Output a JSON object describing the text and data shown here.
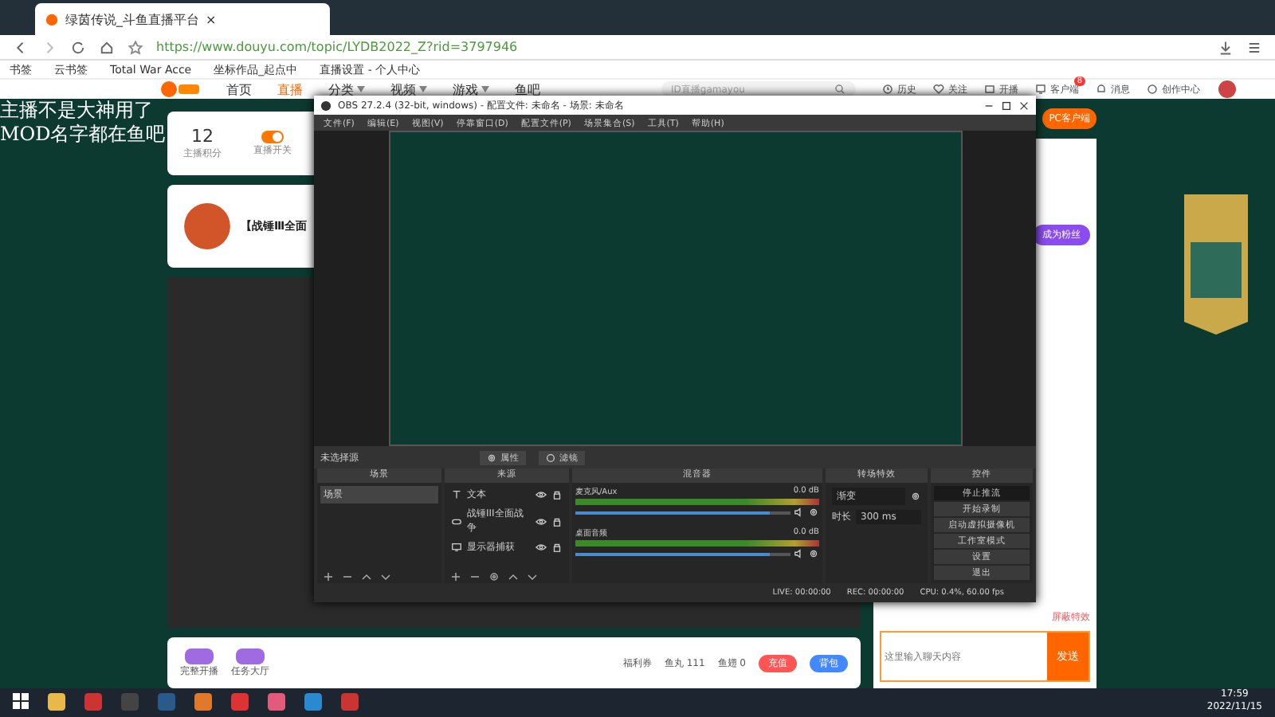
{
  "browser": {
    "tab_title": "绿茵传说_斗鱼直播平台",
    "tab_close": "×",
    "url": "https://www.douyu.com/topic/LYDB2022_Z?rid=3797946",
    "bookmarks": [
      "书签",
      "云书签",
      "Total War Acce",
      "坐标作品_起点中",
      "直播设置 - 个人中心"
    ]
  },
  "site_nav": {
    "items": [
      {
        "label": "首页",
        "selected": false,
        "dropdown": false
      },
      {
        "label": "直播",
        "selected": true,
        "dropdown": false
      },
      {
        "label": "分类",
        "selected": false,
        "dropdown": true
      },
      {
        "label": "视频",
        "selected": false,
        "dropdown": true
      },
      {
        "label": "游戏",
        "selected": false,
        "dropdown": true
      },
      {
        "label": "鱼吧",
        "selected": false,
        "dropdown": false
      }
    ],
    "search_placeholder": "ID直播gamayou",
    "icons": [
      {
        "label": "历史"
      },
      {
        "label": "关注"
      },
      {
        "label": "开播"
      },
      {
        "label": "客户端",
        "badge": "8"
      },
      {
        "label": "消息"
      },
      {
        "label": "创作中心"
      }
    ]
  },
  "overlay_text": [
    "主播不是大神用了",
    "MOD名字都在鱼吧"
  ],
  "room": {
    "score": "12",
    "score_label": "主播积分",
    "switch_label": "直播开关",
    "switch_on": true,
    "title": "【战锤Ⅲ全面"
  },
  "gift_bar": {
    "left": [
      "完整开播",
      "任务大厅"
    ],
    "stats": [
      "福利券",
      "鱼丸 111",
      "鱼翅 0"
    ],
    "buttons": [
      "充值",
      "背包"
    ]
  },
  "chat": {
    "client_badge": "PC客户端",
    "fan_button": "成为粉丝",
    "block_effects": "屏蔽特效",
    "input_placeholder": "这里输入聊天内容",
    "send": "发送"
  },
  "obs": {
    "title": "OBS 27.2.4 (32-bit, windows) - 配置文件: 未命名 - 场景: 未命名",
    "menu": [
      "文件(F)",
      "编辑(E)",
      "视图(V)",
      "停靠窗口(D)",
      "配置文件(P)",
      "场景集合(S)",
      "工具(T)",
      "帮助(H)"
    ],
    "no_source": "未选择源",
    "source_buttons": [
      "属性",
      "滤镜"
    ],
    "docks": {
      "scenes": "场景",
      "sources": "来源",
      "mixer": "混音器",
      "transitions": "转场特效",
      "controls": "控件"
    },
    "scenes": [
      {
        "label": "场景",
        "selected": true
      }
    ],
    "sources": [
      {
        "kind": "text",
        "label": "文本",
        "visible": true,
        "locked": true
      },
      {
        "kind": "game",
        "label": "战锤III全面战争",
        "visible": true,
        "locked": true
      },
      {
        "kind": "display",
        "label": "显示器捕获",
        "visible": true,
        "locked": true
      }
    ],
    "channels": [
      {
        "name": "麦克风/Aux",
        "reading": "0.0 dB",
        "level": 0.9
      },
      {
        "name": "桌面音频",
        "reading": "0.0 dB",
        "level": 0.9
      }
    ],
    "transition": {
      "type": "渐变",
      "duration_label": "时长",
      "duration": "300 ms"
    },
    "controls": [
      {
        "label": "停止推流",
        "selected": true
      },
      {
        "label": "开始录制",
        "selected": false
      },
      {
        "label": "启动虚拟摄像机",
        "selected": false
      },
      {
        "label": "工作室模式",
        "selected": false
      },
      {
        "label": "设置",
        "selected": false
      },
      {
        "label": "退出",
        "selected": false
      }
    ],
    "status": [
      "LIVE: 00:00:00",
      "REC: 00:00:00",
      "CPU: 0.4%, 60.00 fps"
    ]
  },
  "taskbar": {
    "time": "17:59",
    "date": "2022/11/15"
  }
}
